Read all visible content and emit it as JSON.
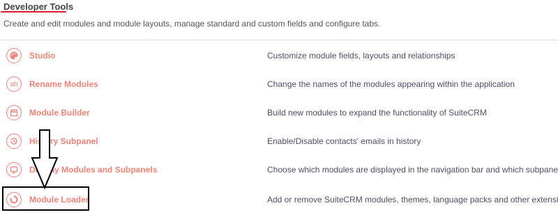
{
  "header": {
    "title": "Developer Tools",
    "subtitle": "Create and edit modules and module layouts, manage standard and custom fields and configure tabs."
  },
  "colors": {
    "link": "#f08377",
    "underline": "#d8202c",
    "text": "#534d64"
  },
  "tools": [
    {
      "label": "Studio",
      "description": "Customize module fields, layouts and relationships",
      "icon": "palette-icon"
    },
    {
      "label": "Rename Modules",
      "description": "Change the names of the modules appearing within the application",
      "icon": "ab-text-icon",
      "icon_text": "ab"
    },
    {
      "label": "Module Builder",
      "description": "Build new modules to expand the functionality of SuiteCRM",
      "icon": "clapperboard-icon"
    },
    {
      "label": "History Subpanel",
      "description": "Enable/Disable contacts' emails in history",
      "icon": "history-icon"
    },
    {
      "label": "Display Modules and Subpanels",
      "description": "Choose which modules are displayed in the navigation bar and which subpanels are disp",
      "icon": "monitor-icon"
    },
    {
      "label": "Module Loader",
      "description": "Add or remove SuiteCRM modules, themes, language packs and other extensions",
      "icon": "loader-ring-icon"
    }
  ]
}
